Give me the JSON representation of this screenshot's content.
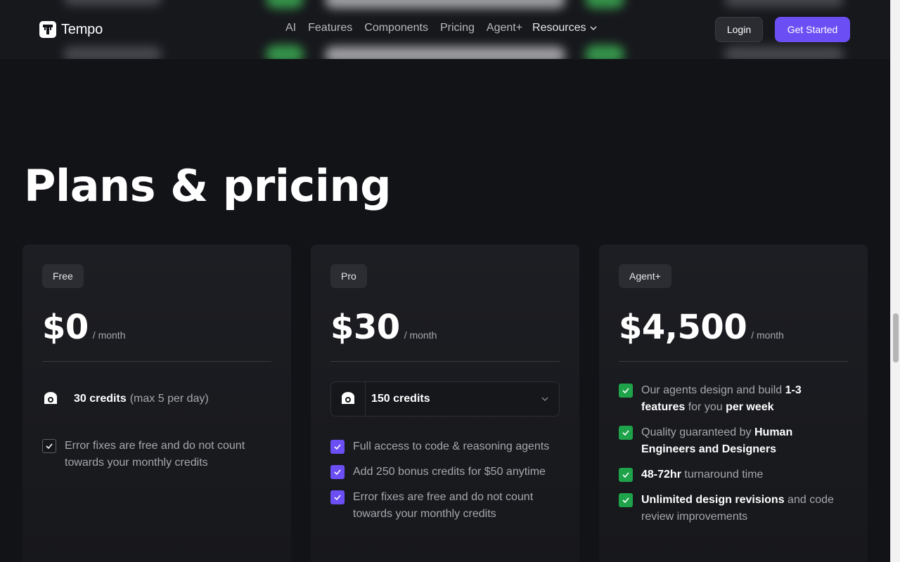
{
  "header": {
    "logo_text": "Tempo",
    "nav": [
      {
        "label": "AI"
      },
      {
        "label": "Features"
      },
      {
        "label": "Components"
      },
      {
        "label": "Pricing"
      },
      {
        "label": "Agent+"
      },
      {
        "label": "Resources"
      }
    ],
    "login_label": "Login",
    "get_started_label": "Get Started"
  },
  "page_title": "Plans & pricing",
  "plans": [
    {
      "tag": "Free",
      "price": "$0",
      "period": "/ month",
      "credits_bold": "30 credits",
      "credits_note": "(max 5 per day)",
      "features": [
        {
          "text": "Error fixes are free and do not count towards your monthly credits"
        }
      ]
    },
    {
      "tag": "Pro",
      "price": "$30",
      "period": "/ month",
      "credits_select": "150 credits",
      "features": [
        {
          "text": "Full access to code & reasoning agents"
        },
        {
          "text": "Add 250 bonus credits for $50 anytime"
        },
        {
          "text": "Error fixes are free and do not count towards your monthly credits"
        }
      ]
    },
    {
      "tag": "Agent+",
      "price": "$4,500",
      "period": "/ month",
      "features": [
        {
          "a": "Our agents design and build ",
          "b": "1-3 features",
          "c": " for you ",
          "d": "per week"
        },
        {
          "a": "Quality guaranteed by ",
          "b": "Human Engineers and Designers"
        },
        {
          "b": "48-72hr",
          "c": " turnaround time"
        },
        {
          "b": "Unlimited design revisions",
          "c": " and code review improvements"
        }
      ]
    }
  ],
  "colors": {
    "background": "#121317",
    "accent": "#6b4ff5",
    "success": "#1ea34a"
  }
}
